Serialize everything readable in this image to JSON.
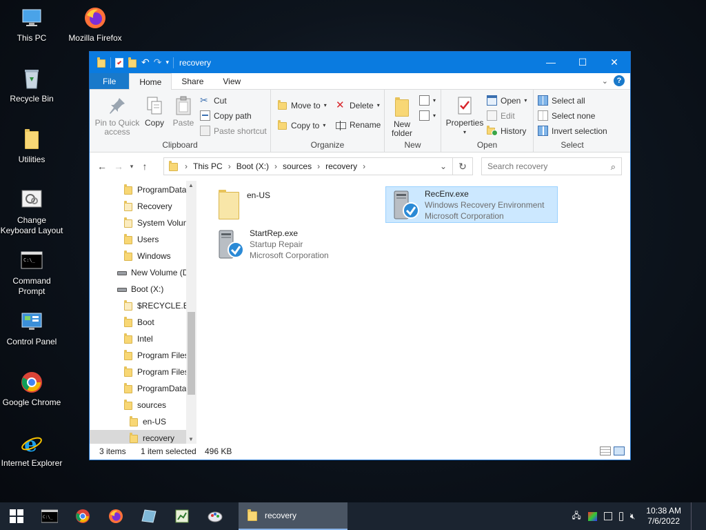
{
  "desktop": {
    "icons": [
      {
        "label": "This PC",
        "icon": "computer-icon"
      },
      {
        "label": "Mozilla Firefox",
        "icon": "firefox-icon"
      },
      {
        "label": "Recycle Bin",
        "icon": "recycle-bin-icon"
      },
      {
        "label": "Utilities",
        "icon": "folder-icon"
      },
      {
        "label": "Change Keyboard Layout",
        "icon": "keyboard-settings-icon"
      },
      {
        "label": "Command Prompt",
        "icon": "cmd-icon"
      },
      {
        "label": "Control Panel",
        "icon": "control-panel-icon"
      },
      {
        "label": "Google Chrome",
        "icon": "chrome-icon"
      },
      {
        "label": "Internet Explorer",
        "icon": "ie-icon"
      }
    ]
  },
  "window": {
    "title": "recovery",
    "tabs": [
      "File",
      "Home",
      "Share",
      "View"
    ],
    "active_tab": "Home",
    "controls": {
      "minimize": "—",
      "maximize": "☐",
      "close": "✕"
    }
  },
  "ribbon": {
    "clipboard": {
      "label": "Clipboard",
      "pin": "Pin to Quick access",
      "pin_line1": "Pin to Quick",
      "pin_line2": "access",
      "copy": "Copy",
      "paste": "Paste",
      "cut": "Cut",
      "copy_path": "Copy path",
      "paste_shortcut": "Paste shortcut"
    },
    "organize": {
      "label": "Organize",
      "move_to": "Move to",
      "copy_to": "Copy to",
      "delete": "Delete",
      "rename": "Rename"
    },
    "new": {
      "label": "New",
      "new_folder_line1": "New",
      "new_folder_line2": "folder"
    },
    "open": {
      "label": "Open",
      "properties": "Properties",
      "open": "Open",
      "edit": "Edit",
      "history": "History"
    },
    "select": {
      "label": "Select",
      "select_all": "Select all",
      "select_none": "Select none",
      "invert": "Invert selection"
    }
  },
  "address": {
    "crumbs": [
      "This PC",
      "Boot (X:)",
      "sources",
      "recovery"
    ],
    "search_placeholder": "Search recovery"
  },
  "nav_pane": {
    "items": [
      {
        "label": "ProgramData",
        "type": "folder",
        "indent": 1
      },
      {
        "label": "Recovery",
        "type": "folder-light",
        "indent": 1
      },
      {
        "label": "System Volun",
        "type": "folder-light",
        "indent": 1
      },
      {
        "label": "Users",
        "type": "folder",
        "indent": 1
      },
      {
        "label": "Windows",
        "type": "folder",
        "indent": 1
      },
      {
        "label": "New Volume (D",
        "type": "drive",
        "indent": 0
      },
      {
        "label": "Boot (X:)",
        "type": "drive",
        "indent": 0
      },
      {
        "label": "$RECYCLE.BIN",
        "type": "folder-light",
        "indent": 1
      },
      {
        "label": "Boot",
        "type": "folder",
        "indent": 1
      },
      {
        "label": "Intel",
        "type": "folder",
        "indent": 1
      },
      {
        "label": "Program Files",
        "type": "folder",
        "indent": 1
      },
      {
        "label": "Program Files",
        "type": "folder",
        "indent": 1
      },
      {
        "label": "ProgramData",
        "type": "folder",
        "indent": 1
      },
      {
        "label": "sources",
        "type": "folder",
        "indent": 1
      },
      {
        "label": "en-US",
        "type": "folder",
        "indent": 2
      },
      {
        "label": "recovery",
        "type": "folder",
        "indent": 2,
        "selected": true
      }
    ]
  },
  "files": [
    {
      "name": "en-US",
      "type": "folder",
      "line2": "",
      "line3": ""
    },
    {
      "name": "RecEnv.exe",
      "type": "exe",
      "line2": "Windows Recovery Environment",
      "line3": "Microsoft Corporation",
      "selected": true
    },
    {
      "name": "StartRep.exe",
      "type": "exe",
      "line2": "Startup Repair",
      "line3": "Microsoft Corporation"
    }
  ],
  "status": {
    "count": "3 items",
    "selected": "1 item selected",
    "size": "496 KB"
  },
  "taskbar": {
    "task_label": "recovery",
    "time": "10:38 AM",
    "date": "7/6/2022"
  },
  "colors": {
    "titlebar": "#0a7be0",
    "file_tab": "#1979ca",
    "selection": "#cce8ff",
    "folder": "#f8d775",
    "taskbar": "#1b2430"
  }
}
